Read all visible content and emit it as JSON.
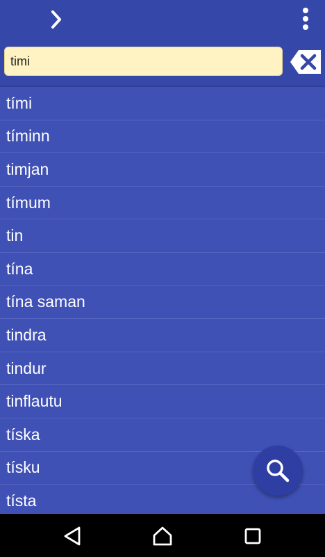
{
  "header": {
    "search": {
      "value": "timi"
    }
  },
  "icons": {
    "forward": "chevron-right-icon",
    "menu": "more-vert-icon",
    "clear": "backspace-clear-icon",
    "search": "search-icon",
    "back": "nav-back-icon",
    "home": "nav-home-icon",
    "recents": "nav-recents-icon"
  },
  "colors": {
    "appbar": "#3547A8",
    "list_background": "#3F51B5",
    "search_field": "#FFF3C4",
    "fab": "#2E3EA3"
  },
  "results": [
    "tími",
    "tíminn",
    "timjan",
    "tímum",
    "tin",
    "tína",
    "tína saman",
    "tindra",
    "tindur",
    "tinflautu",
    "tíska",
    "tísku",
    "tísta"
  ]
}
